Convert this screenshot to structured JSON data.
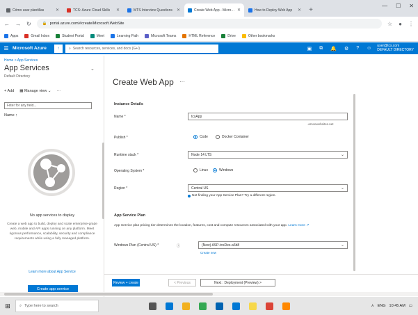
{
  "browser": {
    "tabs": [
      {
        "label": "Cómo usar plantillas",
        "color": "#5f6368"
      },
      {
        "label": "TCS: Azure Cloud Skills",
        "color": "#d93025"
      },
      {
        "label": "MTS Interview Questions",
        "color": "#1a73e8"
      },
      {
        "label": "Create Web App - Microsoft",
        "color": "#0078d4"
      },
      {
        "label": "How to Deploy Web App",
        "color": "#1a73e8"
      }
    ],
    "new_tab": "+",
    "window_controls": [
      "—",
      "☐",
      "✕"
    ],
    "url": "portal.azure.com/#create/Microsoft.WebSite",
    "bookmarks": [
      {
        "label": "Apps",
        "color": "#1a73e8"
      },
      {
        "label": "Gmail Inbox",
        "color": "#d93025"
      },
      {
        "label": "Student Portal",
        "color": "#188038"
      },
      {
        "label": "Meet",
        "color": "#00897b"
      },
      {
        "label": "Learning Path",
        "color": "#1a73e8"
      },
      {
        "label": "Microsoft Teams",
        "color": "#5b5fc7"
      },
      {
        "label": "HTML Reference",
        "color": "#e37400"
      },
      {
        "label": "Drive",
        "color": "#188038"
      },
      {
        "label": "Other bookmarks",
        "color": "#fbbc04"
      }
    ]
  },
  "azure": {
    "brand": "Microsoft Azure",
    "search_placeholder": "Search resources, services, and docs (G+/)",
    "user_line1": "user@tcs.com",
    "user_line2": "DEFAULT DIRECTORY"
  },
  "left": {
    "breadcrumb": "Home > App Services",
    "title": "App Services",
    "subtitle": "Default Directory",
    "add_label": "Add",
    "manage_label": "Manage view",
    "filter_placeholder": "Filter for any field...",
    "column_name": "Name ↑",
    "empty_title": "No app services to display",
    "empty_desc": "Create a web app to build, deploy and scale enterprise-grade web, mobile and API apps running on any platform. Meet rigorous performance, scalability, security and compliance requirements while using a fully managed platform.",
    "learn_more": "Learn more about App Service",
    "create_button": "Create app service"
  },
  "main": {
    "title": "Create Web App",
    "more": "···",
    "section_instance": "Instance Details",
    "name_label": "Name *",
    "name_value": "tcsApp",
    "name_hint": ".azurewebsites.net",
    "publish_label": "Publish *",
    "publish_code": "Code",
    "publish_docker": "Docker Container",
    "runtime_label": "Runtime stack *",
    "runtime_value": "Node 14 LTS",
    "os_label": "Operating System *",
    "os_linux": "Linux",
    "os_windows": "Windows",
    "region_label": "Region *",
    "region_value": "Central US",
    "region_info": "Not finding your App Service Plan? Try a different region.",
    "section_plan": "App Service Plan",
    "plan_desc": "App Service plan pricing tier determines the location, features, cost and compute resources associated with your app.",
    "plan_learn": "Learn more",
    "windows_plan_label": "Windows Plan (Central US) *",
    "windows_plan_value": "(New) ASP-tcsRes-a6b8",
    "create_new": "Create new"
  },
  "footer": {
    "review": "Review + create",
    "previous": "< Previous",
    "next": "Next : Deployment (Preview) >"
  },
  "taskbar": {
    "search_placeholder": "Type here to search",
    "apps": [
      {
        "name": "task-view",
        "color": "#555555"
      },
      {
        "name": "edge",
        "color": "#0078d4"
      },
      {
        "name": "file-explorer",
        "color": "#f2b01e"
      },
      {
        "name": "chrome",
        "color": "#34a853"
      },
      {
        "name": "store",
        "color": "#0063b1"
      },
      {
        "name": "mail",
        "color": "#0078d4"
      },
      {
        "name": "sticky-notes",
        "color": "#f7d84a"
      },
      {
        "name": "chrome-2",
        "color": "#db4437"
      },
      {
        "name": "vlc",
        "color": "#ff8800"
      }
    ],
    "tray": [
      "∧",
      "ENG",
      "10:45 AM"
    ]
  }
}
